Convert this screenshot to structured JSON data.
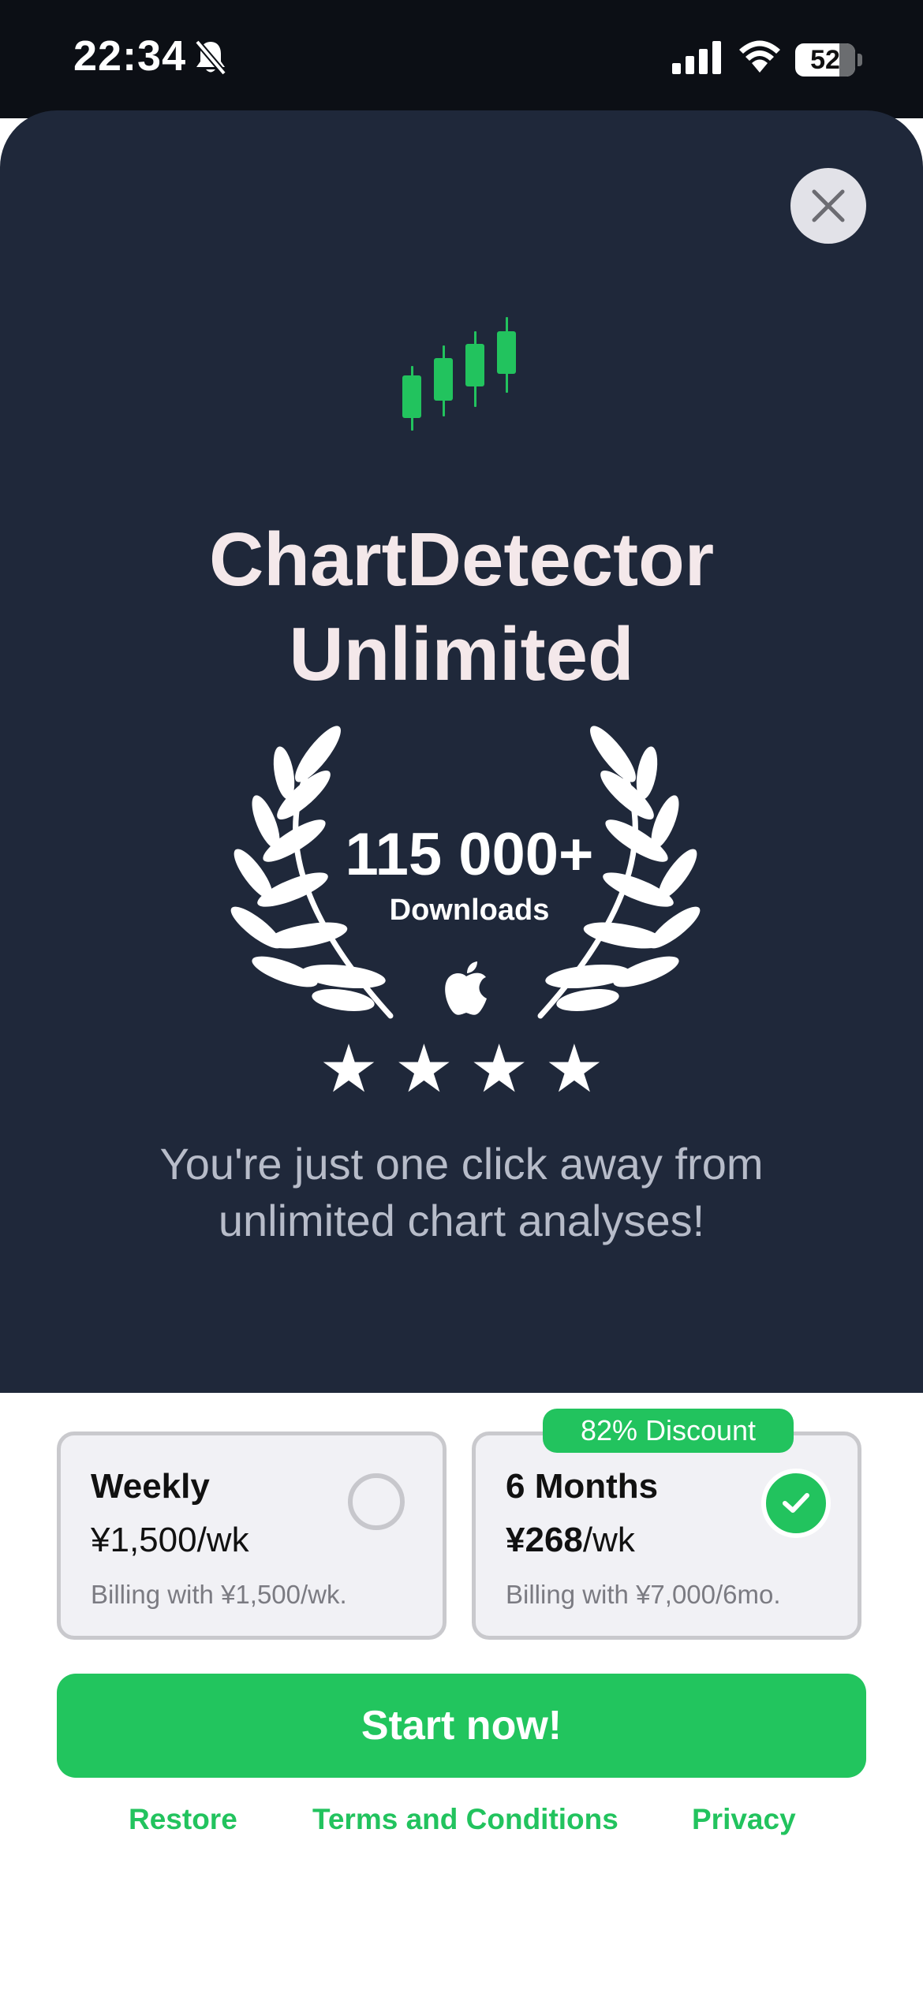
{
  "status_bar": {
    "time": "22:34",
    "battery": "52",
    "icons": [
      "bell-slash-icon",
      "signal-icon",
      "wifi-icon",
      "battery-icon"
    ]
  },
  "paywall": {
    "close_icon": "close-icon",
    "logo_icon": "candlestick-icon",
    "title_line1": "ChartDetector",
    "title_line2": "Unlimited",
    "downloads_count": "115 000+",
    "downloads_label": "Downloads",
    "stars": "★★★★",
    "tagline": "You're just one click away from unlimited chart analyses!",
    "colors": {
      "background": "#1f283a",
      "accent": "#22c55e",
      "title": "#f4e8ea"
    }
  },
  "plans": [
    {
      "name": "Weekly",
      "price_amount": "¥1,500",
      "price_unit": "/wk",
      "billing": "Billing with ¥1,500/wk.",
      "selected": false
    },
    {
      "name": "6 Months",
      "price_amount": "¥268",
      "price_unit": "/wk",
      "billing": "Billing with ¥7,000/6mo.",
      "badge": "82% Discount",
      "selected": true
    }
  ],
  "cta_label": "Start now!",
  "footer": {
    "restore": "Restore",
    "terms": "Terms and Conditions",
    "privacy": "Privacy"
  }
}
